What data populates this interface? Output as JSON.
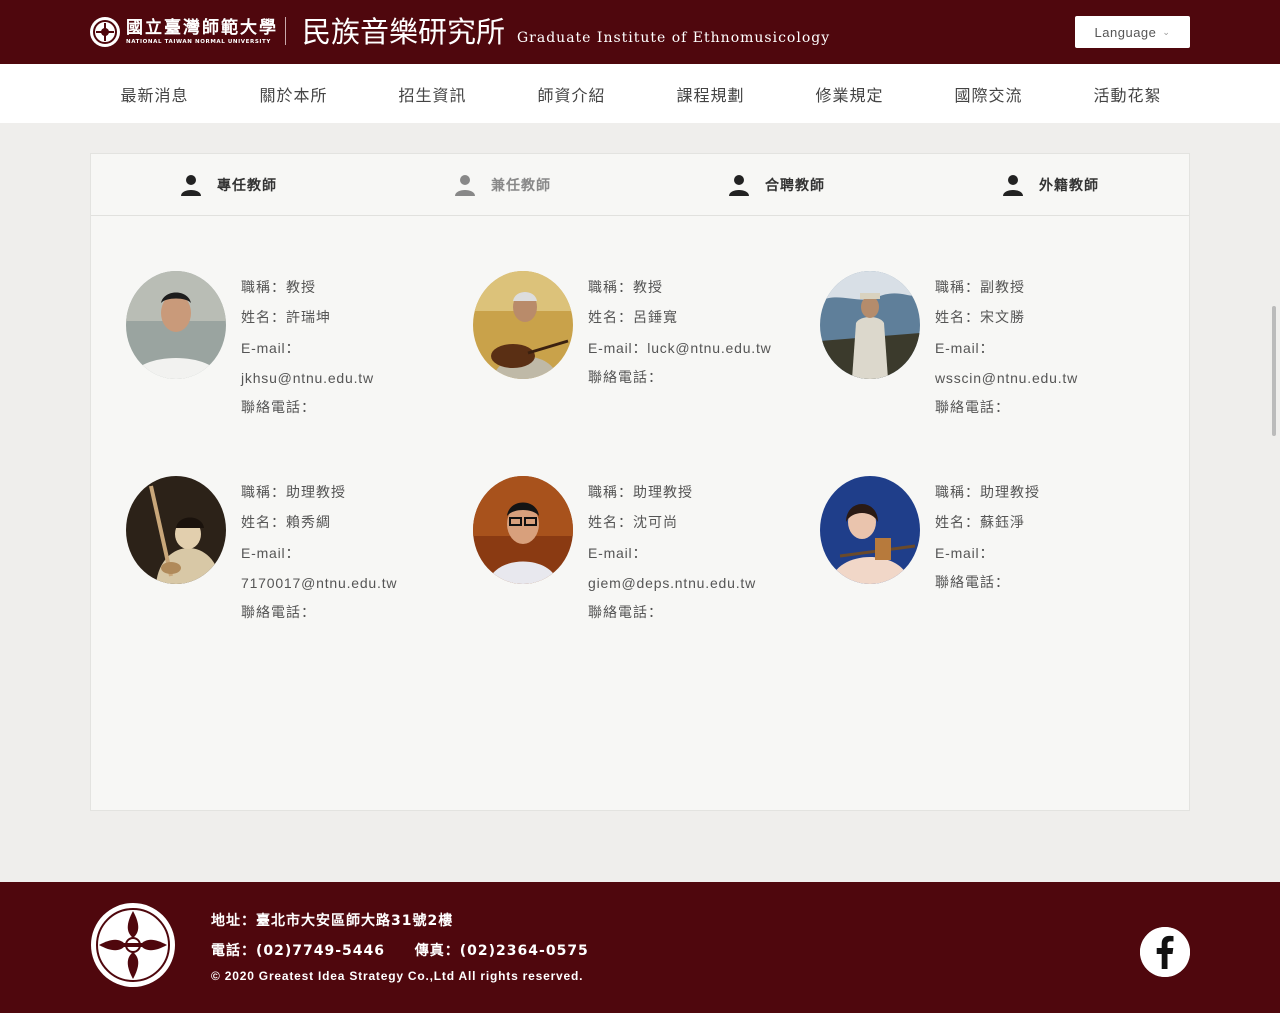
{
  "header": {
    "university_zh": "國立臺灣師範大學",
    "university_en": "NATIONAL TAIWAN NORMAL UNIVERSITY",
    "institute_zh": "民族音樂研究所",
    "institute_en": "Graduate Institute of Ethnomusicology",
    "language_label": "Language"
  },
  "nav": {
    "items": [
      "最新消息",
      "關於本所",
      "招生資訊",
      "師資介紹",
      "課程規劃",
      "修業規定",
      "國際交流",
      "活動花絮"
    ]
  },
  "tabs": [
    {
      "label": "專任教師",
      "active": true
    },
    {
      "label": "兼任教師",
      "active": false
    },
    {
      "label": "合聘教師",
      "active": true
    },
    {
      "label": "外籍教師",
      "active": true
    }
  ],
  "faculty": [
    {
      "title_label": "職稱：",
      "title": "教授",
      "name_label": "姓名：",
      "name": "許瑞坤",
      "email_label": "E-mail：",
      "email": "jkhsu@ntnu.edu.tw",
      "phone_label": "聯絡電話："
    },
    {
      "title_label": "職稱：",
      "title": "教授",
      "name_label": "姓名：",
      "name": "呂錘寬",
      "email_label": "E-mail：",
      "email": "luck@ntnu.edu.tw",
      "phone_label": "聯絡電話："
    },
    {
      "title_label": "職稱：",
      "title": "副教授",
      "name_label": "姓名：",
      "name": "宋文勝",
      "email_label": "E-mail：",
      "email": "wsscin@ntnu.edu.tw",
      "phone_label": "聯絡電話："
    },
    {
      "title_label": "職稱：",
      "title": "助理教授",
      "name_label": "姓名：",
      "name": "賴秀綢",
      "email_label": "E-mail：",
      "email": "7170017@ntnu.edu.tw",
      "phone_label": "聯絡電話："
    },
    {
      "title_label": "職稱：",
      "title": "助理教授",
      "name_label": "姓名：",
      "name": "沈可尚",
      "email_label": "E-mail：",
      "email": "giem@deps.ntnu.edu.tw",
      "phone_label": "聯絡電話："
    },
    {
      "title_label": "職稱：",
      "title": "助理教授",
      "name_label": "姓名：",
      "name": "蘇鈺淨",
      "email_label": "E-mail：",
      "email": "",
      "phone_label": "聯絡電話："
    }
  ],
  "footer": {
    "address": "地址：臺北市大安區師大路31號2樓",
    "phone": "電話：(02)7749-5446",
    "fax": "傳真：(02)2364-0575",
    "copyright": "© 2020 Greatest Idea Strategy Co.,Ltd All rights reserved."
  },
  "colors": {
    "brand": "#4f070d",
    "background": "#efeeec",
    "panel": "#f7f7f5"
  }
}
